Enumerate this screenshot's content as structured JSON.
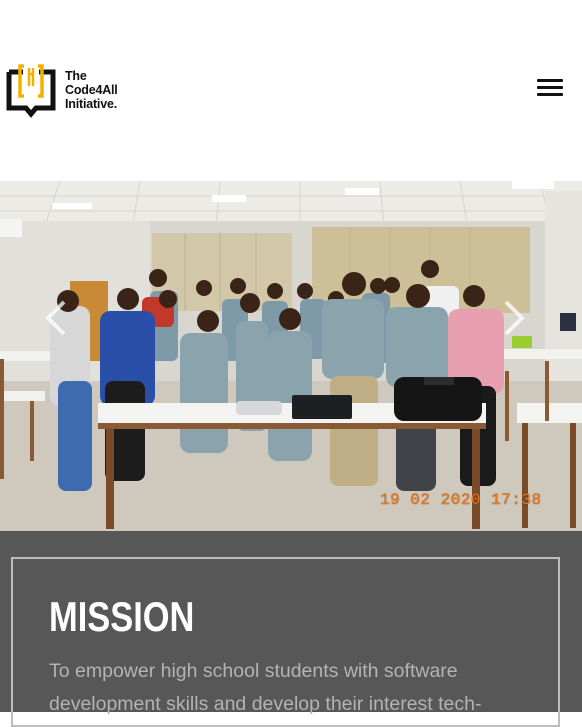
{
  "header": {
    "logo_lines": [
      "The",
      "Code4All",
      "Initiative."
    ],
    "menu_icon": "hamburger-menu-icon"
  },
  "hero": {
    "photo_alt": "Group photo of students in a classroom",
    "timestamp": "19 02 2020  17:38",
    "prev_icon": "chevron-left-icon",
    "next_icon": "chevron-right-icon"
  },
  "mission": {
    "title": "MISSION",
    "text": "To empower high school students with software development skills and develop their interest tech-"
  },
  "colors": {
    "logo_gold": "#f2b100",
    "mission_bg": "#575757",
    "mission_text": "#b3b3b3",
    "stamp": "#f07a18"
  }
}
